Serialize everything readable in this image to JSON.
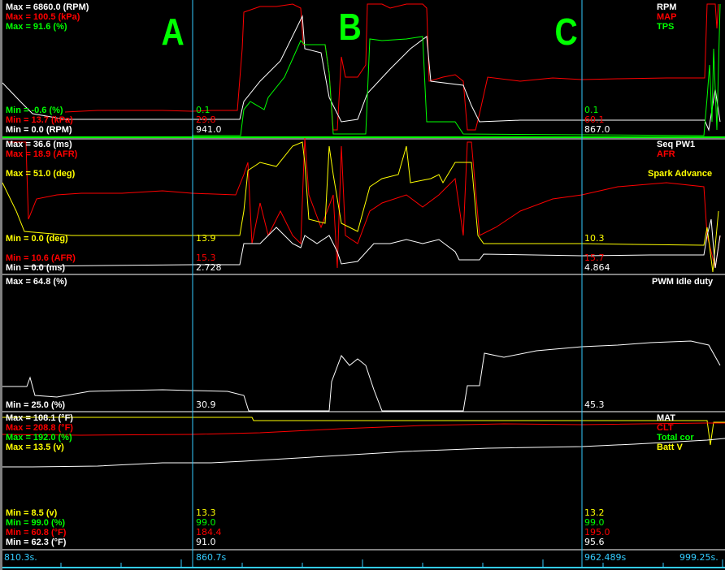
{
  "markers": [
    "A",
    "B",
    "C"
  ],
  "panel1": {
    "max": [
      "Max = 6860.0 (RPM)",
      "Max = 100.5 (kPa)",
      "Max = 91.6 (%)"
    ],
    "min": [
      "Min = -0.6 (%)",
      "Min = 13.7 (kPa)",
      "Min = 0.0 (RPM)"
    ],
    "legend": [
      "RPM",
      "MAP",
      "TPS"
    ],
    "cursor_a": [
      "0.1",
      "29.8",
      "941.0"
    ],
    "cursor_b": [
      "0.1",
      "60.1",
      "867.0"
    ]
  },
  "panel2": {
    "max": [
      "Max = 36.6 (ms)",
      "Max = 18.9 (AFR)",
      "Max = 51.0 (deg)"
    ],
    "min": [
      "Min = 0.0 (deg)",
      "Min = 10.6 (AFR)",
      "Min = 0.0 (ms)"
    ],
    "legend": [
      "Seq PW1",
      "AFR",
      "Spark Advance"
    ],
    "cursor_a": [
      "13.9",
      "15.3",
      "2.728"
    ],
    "cursor_b": [
      "10.3",
      "15.7",
      "4.864"
    ]
  },
  "panel3": {
    "max": "Max = 64.8 (%)",
    "min": "Min = 25.0 (%)",
    "legend": "PWM Idle duty",
    "cursor_a": "30.9",
    "cursor_b": "45.3"
  },
  "panel4": {
    "max": [
      "Max = 108.1 (°F)",
      "Max = 208.8 (°F)",
      "Max = 192.0 (%)",
      "Max = 13.5 (v)"
    ],
    "min": [
      "Min = 8.5 (v)",
      "Min = 99.0 (%)",
      "Min = 60.8 (°F)",
      "Min = 62.3 (°F)"
    ],
    "legend": [
      "MAT",
      "CLT",
      "Total cor",
      "Batt V"
    ],
    "cursor_a": [
      "13.3",
      "99.0",
      "184.4",
      "91.0"
    ],
    "cursor_b": [
      "13.2",
      "99.0",
      "195.0",
      "95.6"
    ]
  },
  "timeline": {
    "start": "810.3s.",
    "cursor_a": "860.7s",
    "cursor_b": "962.489s",
    "end": "999.25s."
  }
}
